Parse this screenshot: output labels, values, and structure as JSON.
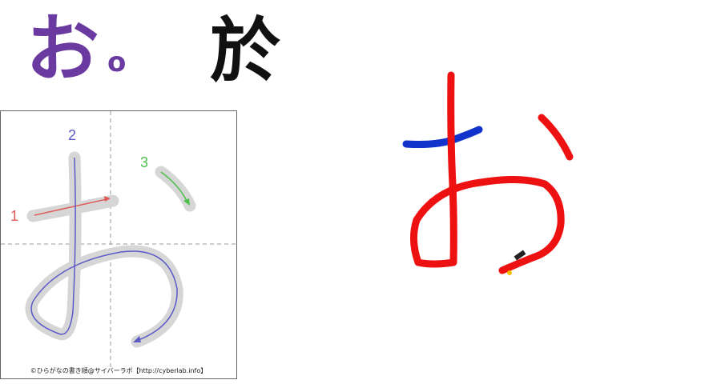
{
  "header": {
    "kana": "お",
    "romaji": "o",
    "kanji_origin": "於"
  },
  "stroke_diagram": {
    "stroke_numbers": [
      "1",
      "2",
      "3"
    ],
    "credit": "©ひらがなの書き順@サイバーラボ【http://cyberlab.info】"
  },
  "colors": {
    "kana_purple": "#6a3aa0",
    "stroke1": "#e05a5a",
    "stroke2": "#5a5ac8",
    "stroke3": "#4cc04c",
    "drawn_red": "#ee1111",
    "drawn_blue": "#1133cc"
  }
}
